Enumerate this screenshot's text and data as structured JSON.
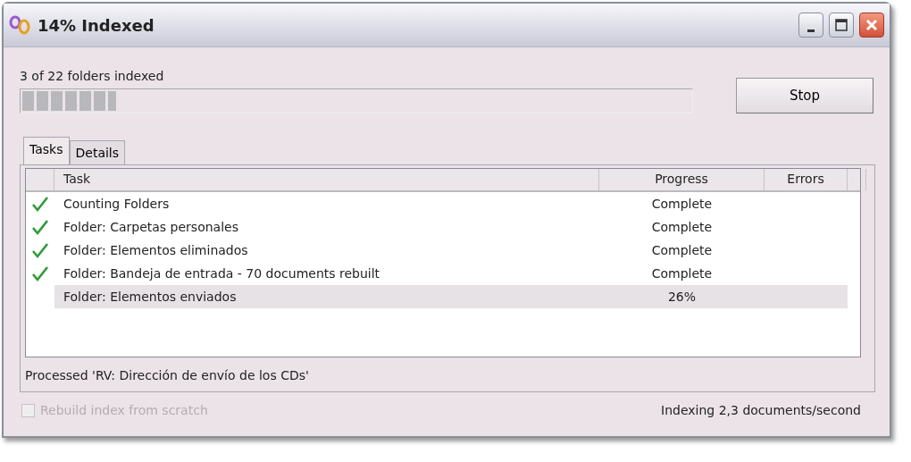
{
  "window": {
    "title": "14% Indexed"
  },
  "summary": "3 of 22 folders indexed",
  "progress": {
    "level": 0.14
  },
  "stop_button": "Stop",
  "tabs": [
    {
      "label": "Tasks",
      "selected": true
    },
    {
      "label": "Details",
      "selected": false
    }
  ],
  "table": {
    "columns": [
      "Task",
      "Progress",
      "Errors"
    ],
    "rows": [
      {
        "done": true,
        "selected": false,
        "task": "Counting Folders",
        "progress": "Complete"
      },
      {
        "done": true,
        "selected": false,
        "task": "Folder: Carpetas personales",
        "progress": "Complete"
      },
      {
        "done": true,
        "selected": false,
        "task": "Folder: Elementos eliminados",
        "progress": "Complete"
      },
      {
        "done": true,
        "selected": false,
        "task": "Folder: Bandeja de entrada - 70 documents rebuilt",
        "progress": "Complete"
      },
      {
        "done": false,
        "selected": true,
        "task": "Folder: Elementos enviados",
        "progress": "26%"
      }
    ]
  },
  "panel_status": "Processed 'RV: Dirección de envío de los CDs'",
  "rebuild_option": {
    "label": "Rebuild index from scratch",
    "checked": false,
    "disabled": true
  },
  "rate": "Indexing 2,3 documents/second"
}
